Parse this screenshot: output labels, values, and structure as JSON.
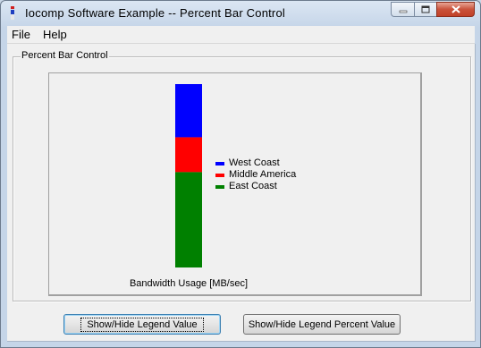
{
  "window": {
    "title": "Iocomp Software Example -- Percent Bar Control",
    "icon": "iocomp-app-icon"
  },
  "menu": [
    "File",
    "Help"
  ],
  "group": {
    "label": "Percent Bar Control"
  },
  "chart_data": {
    "type": "bar",
    "stacked": true,
    "orientation": "vertical",
    "total_percent": 100,
    "series": [
      {
        "name": "West Coast",
        "color": "#0000ff",
        "percent": 29
      },
      {
        "name": "Middle America",
        "color": "#ff0000",
        "percent": 19
      },
      {
        "name": "East Coast",
        "color": "#008000",
        "percent": 52
      }
    ],
    "xlabel": "Bandwidth Usage [MB/sec]",
    "legend_position": "right"
  },
  "buttons": {
    "legend_value": "Show/Hide Legend Value",
    "legend_percent": "Show/Hide Legend Percent Value"
  },
  "colors": {
    "window_frame": "#c5d5e8",
    "client_bg": "#f0f0f0"
  }
}
